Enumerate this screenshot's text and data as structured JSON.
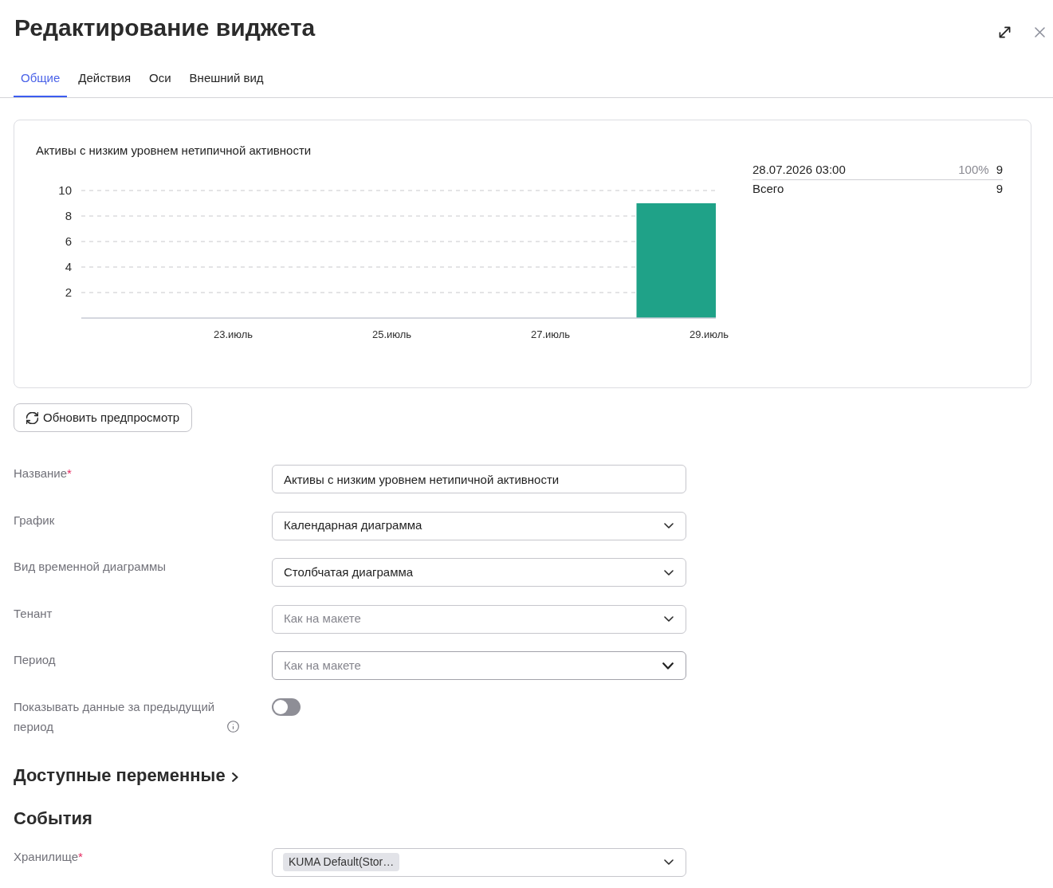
{
  "window": {
    "title": "Редактирование виджета"
  },
  "tabs": [
    {
      "label": "Общие",
      "selected": true
    },
    {
      "label": "Действия",
      "selected": false
    },
    {
      "label": "Оси",
      "selected": false
    },
    {
      "label": "Внешний вид",
      "selected": false
    }
  ],
  "preview": {
    "chart_data": {
      "type": "bar",
      "title": "Активы с низким уровнем нетипичной активности",
      "x": [
        28.625
      ],
      "values": [
        9
      ],
      "xlim": [
        21.125,
        29.125
      ],
      "ylim": [
        0,
        10
      ],
      "xticks": [
        {
          "value": 23,
          "label": "23.июль"
        },
        {
          "value": 25,
          "label": "25.июль"
        },
        {
          "value": 27,
          "label": "27.июль"
        },
        {
          "value": 29,
          "label": "29.июль"
        }
      ],
      "yticks": [
        2,
        4,
        6,
        8,
        10
      ],
      "grid": true
    },
    "legend": {
      "rows": [
        {
          "label": "28.07.2026 03:00",
          "percent": "100%",
          "value": "9"
        }
      ],
      "total": {
        "label": "Всего",
        "value": "9"
      }
    }
  },
  "refresh_button": {
    "label": "Обновить предпросмотр"
  },
  "fields": [
    {
      "kind": "text",
      "label": "Название",
      "required_mark": "*",
      "value": "Активы с низким уровнем нетипичной активности"
    },
    {
      "kind": "select",
      "label": "График",
      "value": "Календарная диаграмма",
      "hovered": false
    },
    {
      "kind": "select",
      "label": "Вид временной диаграммы",
      "value": "Столбчатая диаграмма",
      "hovered": false
    },
    {
      "kind": "select",
      "label": "Тенант",
      "placeholder": "Как на макете",
      "hovered": false
    },
    {
      "kind": "select",
      "label": "Период",
      "placeholder": "Как на макете",
      "hovered": true
    },
    {
      "kind": "toggle",
      "label": "Показывать данные за предыдущий период",
      "info": true,
      "on": false
    }
  ],
  "sections": [
    {
      "kind": "collapsible",
      "title": "Доступные переменные",
      "expanded": false
    },
    {
      "kind": "group",
      "title": "События",
      "fields": [
        {
          "kind": "tags",
          "label": "Хранилище",
          "required_mark": "*",
          "tags": [
            "KUMA Default(Stor…"
          ],
          "hovered": false
        }
      ]
    }
  ]
}
